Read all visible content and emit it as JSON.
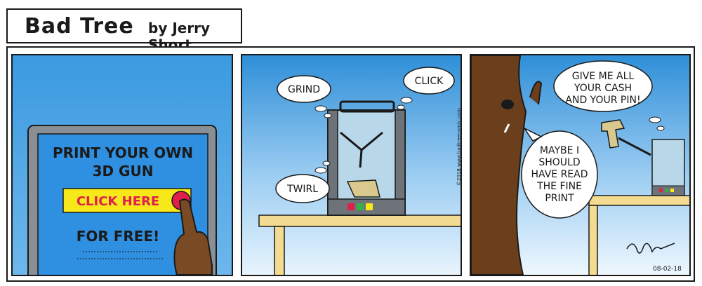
{
  "header": {
    "title": "Bad Tree",
    "byline": "by Jerry Short"
  },
  "panel1": {
    "screen_line1": "PRINT YOUR OWN",
    "screen_line2": "3D GUN",
    "button_label": "CLICK HERE",
    "screen_line3": "FOR FREE!"
  },
  "panel2": {
    "sound1": "GRIND",
    "sound2": "CLICK",
    "sound3": "TWIRL",
    "copyright": "©2018 www.badtreecomic.com"
  },
  "panel3": {
    "speech1_line1": "GIVE ME ALL",
    "speech1_line2": "YOUR CASH",
    "speech1_line3": "AND YOUR PIN!",
    "speech2_line1": "MAYBE I",
    "speech2_line2": "SHOULD",
    "speech2_line3": "HAVE READ",
    "speech2_line4": "THE FINE",
    "speech2_line5": "PRINT",
    "date": "08-02-18"
  },
  "colors": {
    "sky": "#3b9ae0",
    "button_yellow": "#f7e81a",
    "button_text": "#e0204a",
    "trunk": "#6b3f1c",
    "table": "#f3dc92"
  }
}
